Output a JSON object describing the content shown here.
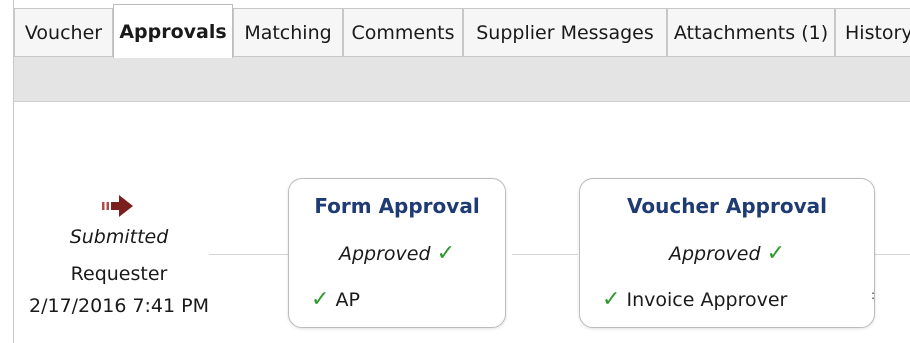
{
  "tabs": [
    {
      "label": "Voucher",
      "active": false
    },
    {
      "label": "Approvals",
      "active": true
    },
    {
      "label": "Matching",
      "active": false
    },
    {
      "label": "Comments",
      "active": false
    },
    {
      "label": "Supplier Messages",
      "active": false
    },
    {
      "label": "Attachments (1)",
      "active": false
    },
    {
      "label": "History",
      "active": false
    }
  ],
  "workflow": {
    "submitted": {
      "icon": "arrow-right-icon",
      "status": "Submitted",
      "role": "Requester",
      "datetime": "2/17/2016 7:41 PM"
    },
    "steps": [
      {
        "title": "Form Approval",
        "status": "Approved",
        "approver": "AP"
      },
      {
        "title": "Voucher Approval",
        "status": "Approved",
        "approver": "Invoice Approver"
      }
    ],
    "check_mark": "✓"
  },
  "colors": {
    "title": "#1f3b73",
    "check": "#2c9a2c",
    "arrow": "#7a1e1e",
    "toolbar": "#e4e4e4"
  }
}
